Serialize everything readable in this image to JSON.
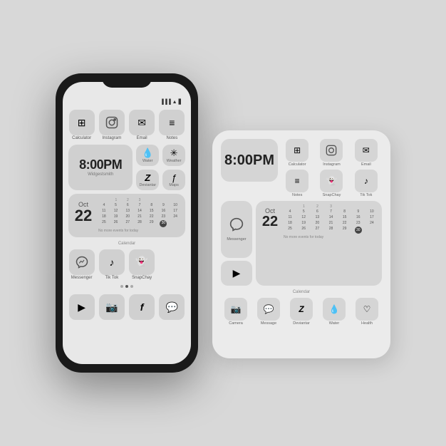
{
  "scene": {
    "bg_color": "#d8d8d8"
  },
  "phone": {
    "time": "8:00PM",
    "time_label": "Widgestsmith",
    "apps_row1": [
      {
        "icon": "⊞",
        "label": "Calculator"
      },
      {
        "icon": "📷",
        "label": "Instagram"
      },
      {
        "icon": "✉",
        "label": "Email"
      },
      {
        "icon": "≡",
        "label": "Notes"
      }
    ],
    "widget_water": {
      "icon": "💧",
      "label": "Water"
    },
    "widget_weather": {
      "icon": "☀",
      "label": "Weather"
    },
    "widget_deviantar": {
      "icon": "Z",
      "label": "Deviantar"
    },
    "widget_maps": {
      "icon": "ƒ",
      "label": "Maps"
    },
    "calendar": {
      "month": "Oct",
      "day": "22",
      "label": "Calendar",
      "no_events": "No more events for today",
      "days_header": [
        "",
        "",
        "",
        "1",
        "2",
        "3"
      ],
      "rows": [
        [
          "4",
          "5",
          "6",
          "7",
          "8",
          "9",
          "10"
        ],
        [
          "11",
          "12",
          "13",
          "14",
          "15",
          "16",
          "17"
        ],
        [
          "18",
          "19",
          "20",
          "21",
          "22",
          "23",
          "24"
        ],
        [
          "25",
          "26",
          "27",
          "28",
          "29",
          "30",
          ""
        ]
      ],
      "today": "30"
    },
    "apps_row3": [
      {
        "icon": "💬",
        "label": "Messenger"
      },
      {
        "icon": "♪",
        "label": "Tik Tok"
      },
      {
        "icon": "👻",
        "label": "SnapChay"
      }
    ],
    "dock": [
      {
        "icon": "▶",
        "label": ""
      },
      {
        "icon": "📸",
        "label": ""
      },
      {
        "icon": "f",
        "label": ""
      },
      {
        "icon": "💬",
        "label": ""
      }
    ]
  },
  "tablet": {
    "time": "8:00PM",
    "row1_icons": [
      {
        "icon": "⊞",
        "label": "Calculator"
      },
      {
        "icon": "📷",
        "label": "Instagram"
      },
      {
        "icon": "✉",
        "label": "Email"
      }
    ],
    "row2_icons": [
      {
        "icon": "≡",
        "label": "Notes"
      },
      {
        "icon": "👻",
        "label": "SnapChay"
      },
      {
        "icon": "♪",
        "label": "Tik Tok"
      }
    ],
    "messenger_label": "Messenger",
    "youtube_label": "",
    "calendar": {
      "month": "Oct",
      "day": "22",
      "label": "Calendar",
      "no_events": "No more events for today",
      "rows": [
        [
          "4",
          "5",
          "6",
          "7",
          "8",
          "9",
          "10"
        ],
        [
          "11",
          "12",
          "13",
          "14",
          "15",
          "16",
          "17"
        ],
        [
          "18",
          "19",
          "20",
          "21",
          "22",
          "23",
          "24"
        ],
        [
          "25",
          "26",
          "27",
          "28",
          "29",
          "30",
          ""
        ]
      ],
      "today": "30"
    },
    "bottom_icons": [
      {
        "icon": "📸",
        "label": "Camera"
      },
      {
        "icon": "💬",
        "label": "Message"
      },
      {
        "icon": "Z",
        "label": "Deviantar"
      },
      {
        "icon": "💧",
        "label": "Water"
      },
      {
        "icon": "♡",
        "label": "Health"
      }
    ]
  }
}
